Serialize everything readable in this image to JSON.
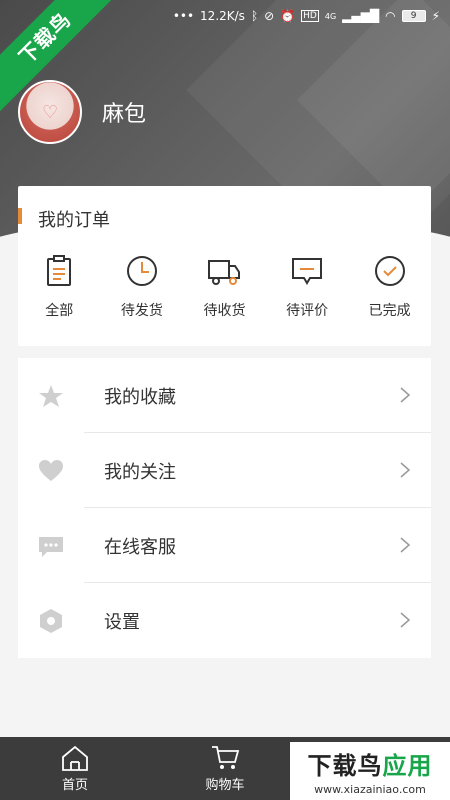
{
  "status_bar": {
    "speed": "12.2K/s",
    "network": "4G",
    "battery": "9"
  },
  "ribbon": {
    "text": "下载鸟"
  },
  "profile": {
    "username": "麻包"
  },
  "orders": {
    "title": "我的订单",
    "items": [
      {
        "label": "全部",
        "icon": "clipboard-icon"
      },
      {
        "label": "待发货",
        "icon": "clock-icon"
      },
      {
        "label": "待收货",
        "icon": "truck-icon"
      },
      {
        "label": "待评价",
        "icon": "comment-icon"
      },
      {
        "label": "已完成",
        "icon": "check-circle-icon"
      }
    ],
    "accent_color": "#e58a3a"
  },
  "menu": {
    "items": [
      {
        "label": "我的收藏",
        "icon": "star-icon"
      },
      {
        "label": "我的关注",
        "icon": "heart-icon"
      },
      {
        "label": "在线客服",
        "icon": "chat-icon"
      },
      {
        "label": "设置",
        "icon": "settings-hexagon-icon"
      }
    ]
  },
  "tabbar": {
    "items": [
      {
        "label": "首页",
        "icon": "home-icon"
      },
      {
        "label": "购物车",
        "icon": "cart-icon"
      }
    ]
  },
  "watermark": {
    "brand_a": "下载鸟",
    "brand_b": "应用",
    "url": "www.xiazainiao.com"
  }
}
